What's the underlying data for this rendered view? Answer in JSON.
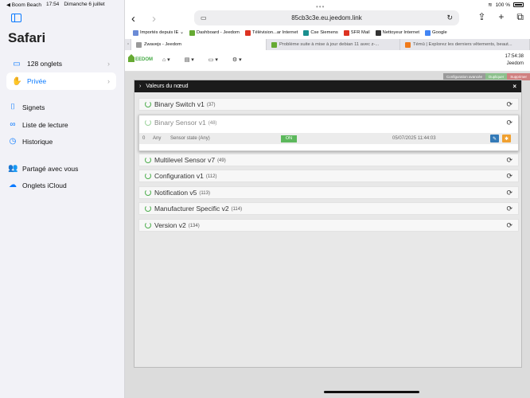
{
  "status_bar": {
    "app_back": "◀ Boom Beach",
    "time": "17:54",
    "date": "Dimanche 6 juillet",
    "battery": "100 %"
  },
  "sidebar": {
    "title": "Safari",
    "tabs_item": "128 onglets",
    "private_item": "Privée",
    "links": [
      {
        "label": "Signets",
        "icon": "bookmark-icon"
      },
      {
        "label": "Liste de lecture",
        "icon": "glasses-icon"
      },
      {
        "label": "Historique",
        "icon": "clock-icon"
      }
    ],
    "shared_links": [
      {
        "label": "Partagé avec vous",
        "icon": "people-icon"
      },
      {
        "label": "Onglets iCloud",
        "icon": "cloud-icon"
      }
    ]
  },
  "browser": {
    "url": "85cb3c3e.eu.jeedom.link",
    "bookmarks": [
      {
        "label": "Importés depuis IE ⌄",
        "color": "#6b8bd6"
      },
      {
        "label": "Dashboard - Jeedom",
        "color": "#6a3"
      },
      {
        "label": "Télévision...ar Internet",
        "color": "#d32"
      },
      {
        "label": "Cse Siemens",
        "color": "#1a8f8f"
      },
      {
        "label": "SFR Mail",
        "color": "#d32"
      },
      {
        "label": "Nettoyeur Internet",
        "color": "#333"
      },
      {
        "label": "Google",
        "color": "#4285f4"
      }
    ],
    "tabs": [
      {
        "label": "Zwavejs - Jeedom",
        "color": "#999",
        "active": true
      },
      {
        "label": "Problème suite à mise à jour debian 11 avec z-...",
        "color": "#6a3",
        "active": false
      },
      {
        "label": "Témū | Explorez les derniers vêtements, beaut...",
        "color": "#f07a1a",
        "active": false
      }
    ]
  },
  "jeedom": {
    "logo_text": "EEDOM",
    "menus": [
      "⌂ ▾",
      "▤ ▾",
      "▭ ▾",
      "⚙ ▾"
    ],
    "time": "17:54:38",
    "user": "Jeedom",
    "actions": [
      "Configuration avancée",
      "Dupliquer",
      "Supprimer"
    ]
  },
  "modal": {
    "title": "Valeurs du nœud",
    "close": "×",
    "classes": [
      {
        "name": "Binary Switch v1",
        "count": "(37)"
      },
      {
        "name": "Multilevel Sensor v7",
        "count": "(49)"
      },
      {
        "name": "Configuration v1",
        "count": "(112)"
      },
      {
        "name": "Notification v5",
        "count": "(113)"
      },
      {
        "name": "Manufacturer Specific v2",
        "count": "(114)"
      },
      {
        "name": "Version v2",
        "count": "(134)"
      }
    ],
    "expanded": {
      "name": "Binary Sensor v1",
      "count": "(48)",
      "value_row": {
        "index": "0",
        "type": "Any",
        "label": "Sensor state (Any)",
        "value": "ON",
        "date": "05/07/2025 11:44:03"
      }
    }
  }
}
